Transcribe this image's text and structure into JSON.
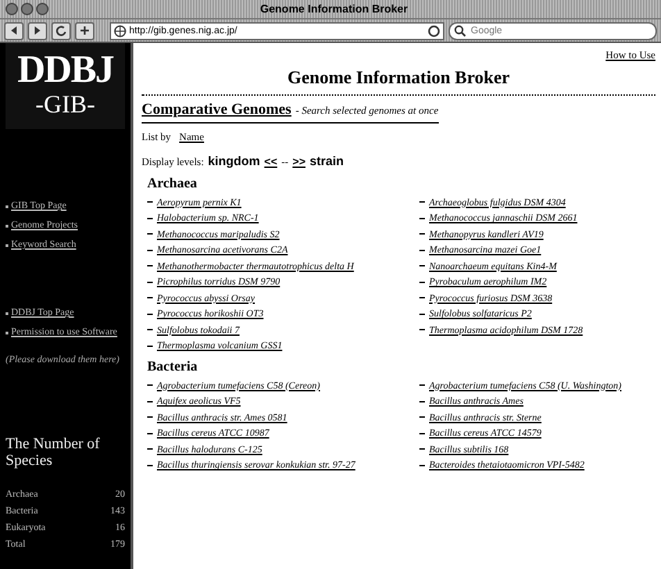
{
  "window": {
    "title": "Genome Information Broker",
    "url": "http://gib.genes.nig.ac.jp/",
    "search_placeholder": "Google"
  },
  "sidebar": {
    "logo_top": "DDBJ",
    "logo_bottom": "-GIB-",
    "links": [
      {
        "label": "GIB Top Page"
      },
      {
        "label": "Genome Projects"
      },
      {
        "label": "Keyword Search"
      }
    ],
    "links_2": [
      {
        "label": "DDBJ Top Page"
      },
      {
        "label": "Permission to use Software"
      }
    ],
    "note": "(Please download them here)",
    "species_title": "The Number of Species",
    "species": [
      {
        "label": "Archaea",
        "count": "20"
      },
      {
        "label": "Bacteria",
        "count": "143"
      },
      {
        "label": "Eukaryota",
        "count": "16"
      },
      {
        "label": "Total",
        "count": "179"
      }
    ]
  },
  "content": {
    "how_to_use": "How to Use",
    "title": "Genome Information Broker",
    "section_link": "Comparative Genomes",
    "section_note": "- Search selected genomes at once",
    "list_by_label": "List by",
    "list_by_link": "Name",
    "display_label": "Display levels:",
    "level_from": "kingdom",
    "level_prev": "<<",
    "level_sep": "--",
    "level_next": ">>",
    "level_to": "strain",
    "groups": [
      {
        "name": "Archaea",
        "columns": [
          [
            "Aeropyrum pernix K1",
            "Halobacterium sp. NRC-1",
            "Methanococcus maripaludis S2",
            "Methanosarcina acetivorans C2A",
            "Methanothermobacter thermautotrophicus delta H",
            "Picrophilus torridus DSM 9790",
            "Pyrococcus abyssi Orsay",
            "Pyrococcus horikoshii OT3",
            "Sulfolobus tokodaii 7",
            "Thermoplasma volcanium GSS1"
          ],
          [
            "Archaeoglobus fulgidus DSM 4304",
            "Methanococcus jannaschii DSM 2661",
            "Methanopyrus kandleri AV19",
            "Methanosarcina mazei Goe1",
            "Nanoarchaeum equitans Kin4-M",
            "Pyrobaculum aerophilum IM2",
            "Pyrococcus furiosus DSM 3638",
            "Sulfolobus solfataricus P2",
            "Thermoplasma acidophilum DSM 1728"
          ]
        ]
      },
      {
        "name": "Bacteria",
        "columns": [
          [
            "Agrobacterium tumefaciens C58 (Cereon)",
            "Aquifex aeolicus VF5",
            "Bacillus anthracis str. Ames 0581",
            "Bacillus cereus ATCC 10987",
            "Bacillus halodurans C-125",
            "Bacillus thuringiensis serovar konkukian str. 97-27"
          ],
          [
            "Agrobacterium tumefaciens C58 (U. Washington)",
            "Bacillus anthracis Ames",
            "Bacillus anthracis str. Sterne",
            "Bacillus cereus ATCC 14579",
            "Bacillus subtilis 168",
            "Bacteroides thetaiotaomicron VPI-5482"
          ]
        ]
      }
    ]
  }
}
